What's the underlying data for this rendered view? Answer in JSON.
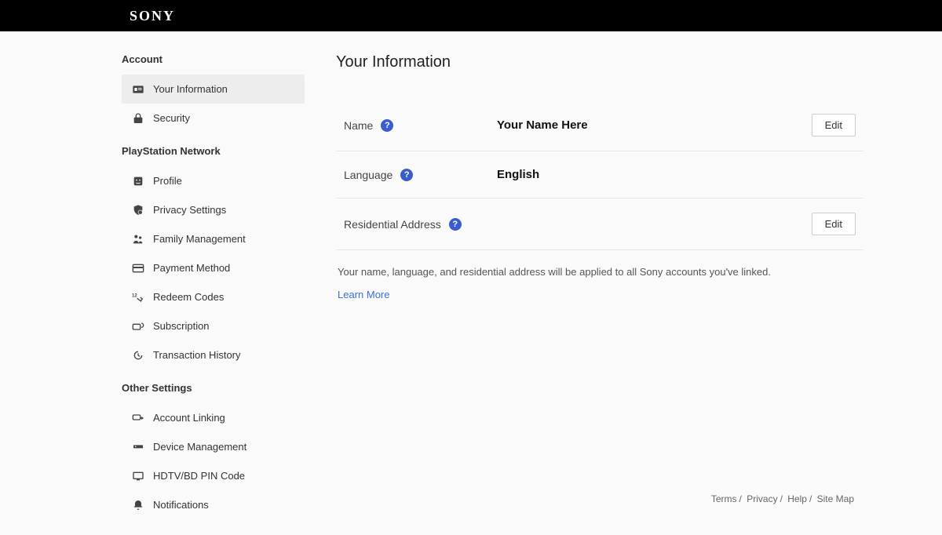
{
  "brand": "SONY",
  "sidebar": {
    "sections": [
      {
        "header": "Account",
        "items": [
          {
            "label": "Your Information",
            "active": true,
            "icon": "id-card-icon"
          },
          {
            "label": "Security",
            "active": false,
            "icon": "lock-icon"
          }
        ]
      },
      {
        "header": "PlayStation Network",
        "items": [
          {
            "label": "Profile",
            "active": false,
            "icon": "profile-icon"
          },
          {
            "label": "Privacy Settings",
            "active": false,
            "icon": "shield-user-icon"
          },
          {
            "label": "Family Management",
            "active": false,
            "icon": "family-icon"
          },
          {
            "label": "Payment Method",
            "active": false,
            "icon": "card-icon"
          },
          {
            "label": "Redeem Codes",
            "active": false,
            "icon": "redeem-icon"
          },
          {
            "label": "Subscription",
            "active": false,
            "icon": "subscription-icon"
          },
          {
            "label": "Transaction History",
            "active": false,
            "icon": "history-icon"
          }
        ]
      },
      {
        "header": "Other Settings",
        "items": [
          {
            "label": "Account Linking",
            "active": false,
            "icon": "link-icon"
          },
          {
            "label": "Device Management",
            "active": false,
            "icon": "device-icon"
          },
          {
            "label": "HDTV/BD PIN Code",
            "active": false,
            "icon": "monitor-icon"
          },
          {
            "label": "Notifications",
            "active": false,
            "icon": "bell-icon"
          }
        ]
      }
    ]
  },
  "main": {
    "title": "Your Information",
    "rows": {
      "name": {
        "label": "Name",
        "value": "Your Name Here",
        "edit": "Edit"
      },
      "language": {
        "label": "Language",
        "value": "English"
      },
      "address": {
        "label": "Residential Address",
        "value": "",
        "edit": "Edit"
      }
    },
    "note": "Your name, language, and residential address will be applied to all Sony accounts you've linked.",
    "learn_more": "Learn More"
  },
  "footer": {
    "terms": "Terms",
    "privacy": "Privacy",
    "help": "Help",
    "sitemap": "Site Map"
  }
}
